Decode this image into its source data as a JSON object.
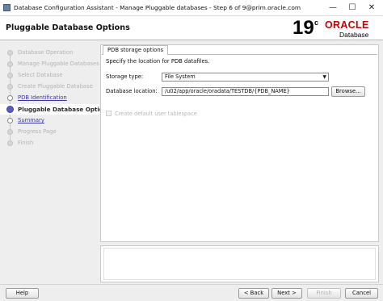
{
  "window": {
    "title": "Database Configuration Assistant - Manage Pluggable databases - Step 6 of 9@prim.oracle.com",
    "minimize": "—",
    "maximize": "☐",
    "close": "✕"
  },
  "header": {
    "page_title": "Pluggable Database Options",
    "logo_version": "19",
    "logo_superscript": "c",
    "logo_brand": "ORACLE",
    "logo_product": "Database"
  },
  "nav": {
    "items": [
      {
        "label": "Database Operation",
        "state": "done"
      },
      {
        "label": "Manage Pluggable Databases",
        "state": "done"
      },
      {
        "label": "Select Database",
        "state": "done"
      },
      {
        "label": "Create Pluggable Database",
        "state": "done"
      },
      {
        "label": "PDB Identification",
        "state": "link"
      },
      {
        "label": "Pluggable Database Options",
        "state": "current"
      },
      {
        "label": "Summary",
        "state": "link"
      },
      {
        "label": "Progress Page",
        "state": "pending"
      },
      {
        "label": "Finish",
        "state": "pending"
      }
    ]
  },
  "panel": {
    "tab_label": "PDB storage options",
    "description": "Specify the location for PDB datafiles.",
    "storage_type_label": "Storage type:",
    "storage_type_value": "File System",
    "location_label": "Database location:",
    "location_value": "/u02/app/oracle/oradata/TESTDB/{PDB_NAME}",
    "browse_label": "Browse...",
    "tablespace_label": "Create default user tablespace",
    "tablespace_checked": false
  },
  "footer": {
    "help_label": "Help",
    "back_label": "< Back",
    "next_label": "Next >",
    "finish_label": "Finish",
    "cancel_label": "Cancel"
  }
}
